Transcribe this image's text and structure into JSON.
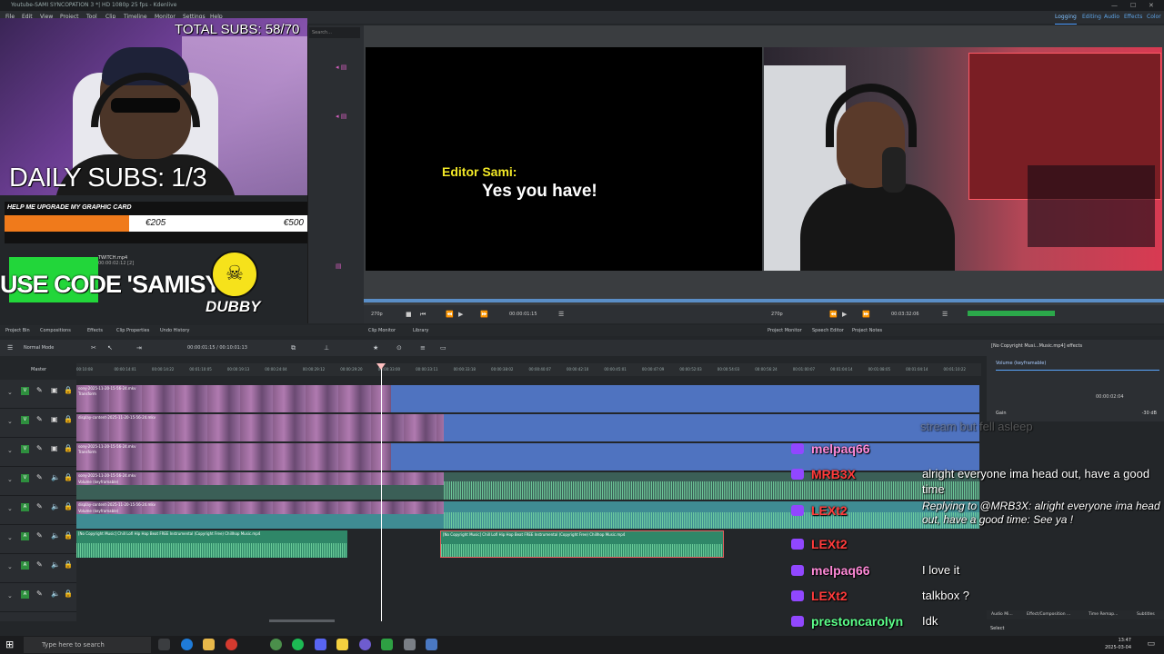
{
  "window": {
    "title": "Youtube-SAMI SYNCOPATION 3 *| HD 1080p 25 fps - Kdenlive",
    "controls": [
      "—",
      "☐",
      "✕"
    ]
  },
  "menu": [
    "File",
    "Edit",
    "View",
    "Project",
    "Tool",
    "Clip",
    "Timeline",
    "Monitor",
    "Settings",
    "Help"
  ],
  "layouts": [
    "Logging",
    "Editing",
    "Audio",
    "Effects",
    "Color"
  ],
  "overlay": {
    "total_subs": "TOTAL SUBS: 58/70",
    "daily_subs": "DAILY SUBS: 1/3",
    "goal_title": "HELP ME UPGRADE MY GRAPHIC CARD",
    "goal_current": "€205",
    "goal_max": "€500",
    "goal_progress": 0.41,
    "use_code": "USE CODE 'SAMISY'",
    "dubby": "DUBBY"
  },
  "bin": {
    "search_placeholder": "Search...",
    "clip_name": "TWITCH.mp4",
    "clip_duration": "00:00:02:12 [2]"
  },
  "clip_monitor": {
    "editor_name": "Editor Sami:",
    "line": "Yes you have!",
    "zoom": "270p",
    "timecode": "00:00:01:15"
  },
  "project_monitor": {
    "zoom": "270p",
    "timecode": "00:03:32:06"
  },
  "tabs": [
    "Project Bin",
    "Compositions",
    "Effects",
    "Clip Properties",
    "Undo History",
    "Clip Monitor",
    "Library",
    "Project Monitor",
    "Speech Editor",
    "Project Notes"
  ],
  "timeline": {
    "mode": "Normal Mode",
    "timecode": "00:00:01:15 / 00:10:01:13",
    "master_label": "Master",
    "ruler": [
      "00:10:08",
      "00:00:14:01",
      "00:00:14:22",
      "00:01:10:05",
      "00:00:19:13",
      "00:00:24:04",
      "00:00:29:12",
      "00:00:29:20",
      "00:00:33:00",
      "00:00:33:11",
      "00:00:33:18",
      "00:00:38:02",
      "00:00:40:07",
      "00:00:42:10",
      "00:00:45:01",
      "00:00:47:09",
      "00:00:52:03",
      "00:00:54:03",
      "00:00:56:24",
      "00:01:00:07",
      "00:01:04:14",
      "00:01:08:05",
      "00:01:04:14",
      "00:01:10:22"
    ],
    "video_clip": "sony-2025-11-20-15-56-24.mkv",
    "display_clip": "display-content-2025-11-20-15-56-24.mkv",
    "transform": "Transform",
    "volume": "Volume (keyframable)",
    "music_clip": "[No Copyright Music] Chill Lofi Hip Hop Beat FREE Instrumental (Copyright Free) Chillhop Music.mp4"
  },
  "effects_panel": {
    "title": "[No Copyright Musi...Music.mp4] effects",
    "volume": "Volume (keyframable)",
    "timecode": "00:00:02:04",
    "gain_label": "Gain",
    "gain_value": "-30 dB"
  },
  "chat": [
    {
      "user": "",
      "text": "stream but fell asleep",
      "faded": true
    },
    {
      "user": "melpaq66",
      "color": "#ff8ad8",
      "text": ""
    },
    {
      "user": "MRB3X",
      "color": "#ff3b3b",
      "text": "alright everyone ima head out, have a good time"
    },
    {
      "user": "LEXt2",
      "color": "#ff3b3b",
      "text": "Replying to @MRB3X: alright everyone ima head out, have a good time:  See ya !"
    },
    {
      "user": "LEXt2",
      "color": "#ff3b3b",
      "text": ""
    },
    {
      "user": "melpaq66",
      "color": "#ff8ad8",
      "text": "I love it"
    },
    {
      "user": "LEXt2",
      "color": "#ff3b3b",
      "text": "talkbox ?"
    },
    {
      "user": "prestoncarolyn",
      "color": "#5cff8a",
      "text": "Idk"
    }
  ],
  "bottom_tabs": [
    "Audio Mi...",
    "Effect/Composition ...",
    "Time Remap...",
    "Subtitles"
  ],
  "status": {
    "select": "Select"
  },
  "taskbar": {
    "search_placeholder": "Type here to search",
    "time": "13:47",
    "date": "2025-03-04"
  }
}
